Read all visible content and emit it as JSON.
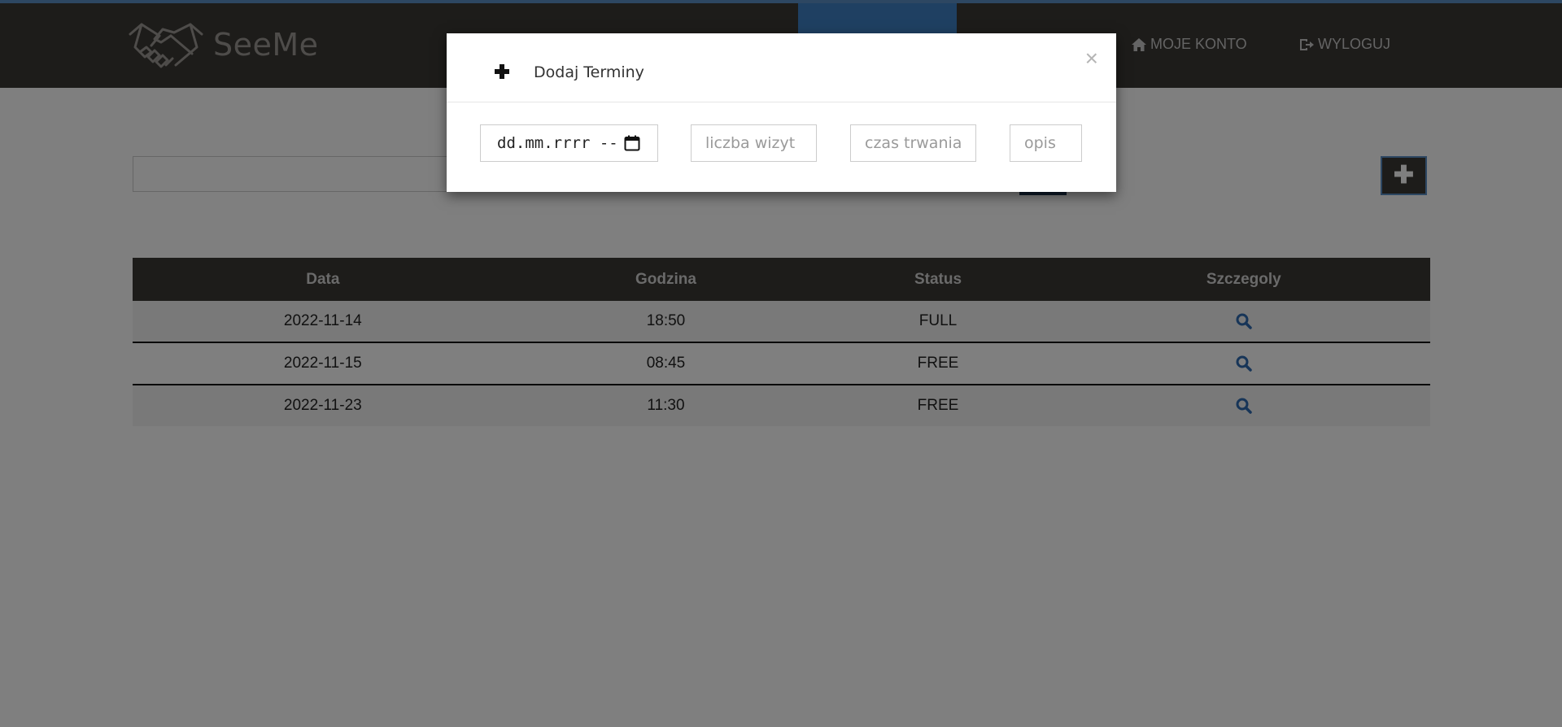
{
  "brand": {
    "name": "SeeMe"
  },
  "nav": {
    "account_label": "MOJE KONTO",
    "logout_label": "WYLOGUJ"
  },
  "toolbar": {
    "add_label": "✚"
  },
  "table": {
    "headers": [
      "Data",
      "Godzina",
      "Status",
      "Szczegoly"
    ],
    "rows": [
      {
        "date": "2022-11-14",
        "time": "18:50",
        "status": "FULL"
      },
      {
        "date": "2022-11-15",
        "time": "08:45",
        "status": "FREE"
      },
      {
        "date": "2022-11-23",
        "time": "11:30",
        "status": "FREE"
      }
    ]
  },
  "modal": {
    "title": "Dodaj Terminy",
    "close_label": "×",
    "date_placeholder": "dd.mm.rrrr --",
    "visits_placeholder": "liczba wizyt",
    "duration_placeholder": "czas trwania",
    "description_placeholder": "opis"
  },
  "colors": {
    "navbar": "#3b3834",
    "accent": "#3e81c4",
    "search_button": "#1d3552",
    "details_icon": "#2f6bb0"
  }
}
